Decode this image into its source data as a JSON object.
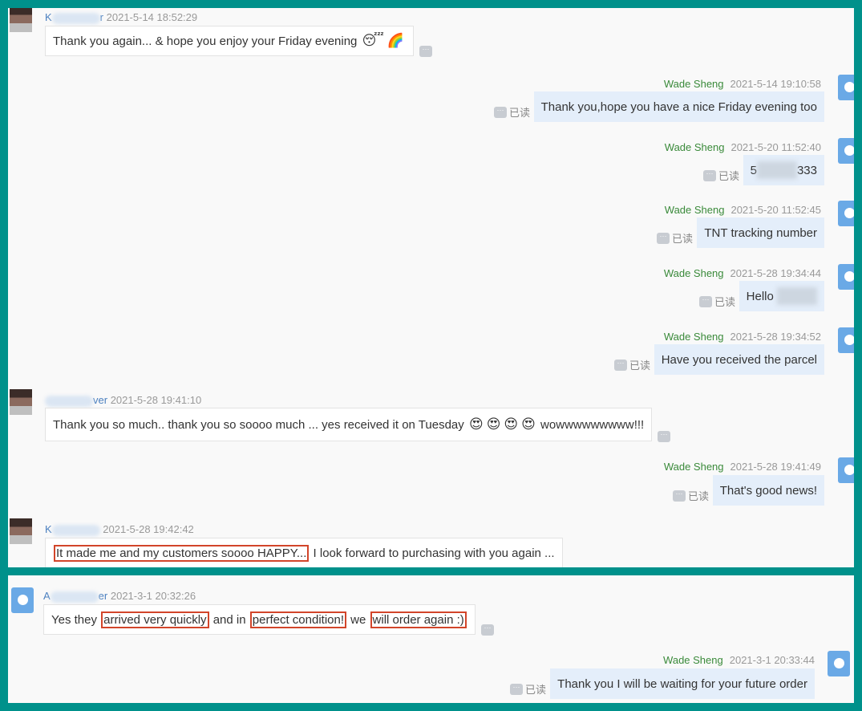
{
  "read_label": "已读",
  "colors": {
    "frame": "#00918b",
    "highlight": "#d2452a",
    "self_name": "#3a8a3a",
    "outgoing_bubble": "#e4eefa"
  },
  "panels": [
    {
      "messages": [
        {
          "dir": "in",
          "name_start": "K",
          "name_end": "r",
          "time": "2021-5-14 18:52:29",
          "segments": [
            {
              "text": "Thank you again... & hope you enjoy your Friday evening "
            },
            {
              "emoji": "😴"
            },
            {
              "emoji": "🌈"
            }
          ]
        },
        {
          "dir": "out",
          "name": "Wade Sheng",
          "time": "2021-5-14 19:10:58",
          "segments": [
            {
              "text": "Thank you,hope you have a nice Friday evening too"
            }
          ]
        },
        {
          "dir": "out",
          "name": "Wade Sheng",
          "time": "2021-5-20 11:52:40",
          "segments": [
            {
              "text": "5"
            },
            {
              "redacted": true
            },
            {
              "text": "333"
            }
          ]
        },
        {
          "dir": "out",
          "name": "Wade Sheng",
          "time": "2021-5-20 11:52:45",
          "segments": [
            {
              "text": "TNT tracking number"
            }
          ]
        },
        {
          "dir": "out",
          "name": "Wade Sheng",
          "time": "2021-5-28 19:34:44",
          "segments": [
            {
              "text": "Hello "
            },
            {
              "redacted": true
            }
          ]
        },
        {
          "dir": "out",
          "name": "Wade Sheng",
          "time": "2021-5-28 19:34:52",
          "segments": [
            {
              "text": "Have you received the parcel"
            }
          ]
        },
        {
          "dir": "in",
          "name_start": "",
          "name_end": "ver",
          "time": "2021-5-28 19:41:10",
          "segments": [
            {
              "text": "Thank you so much.. thank you so soooo much ... yes received it on Tuesday "
            },
            {
              "emoji": "😍"
            },
            {
              "emoji": "😍"
            },
            {
              "emoji": "😍"
            },
            {
              "emoji": "😍"
            },
            {
              "text": " wowwwwwwwww!!!"
            }
          ]
        },
        {
          "dir": "out",
          "name": "Wade Sheng",
          "time": "2021-5-28 19:41:49",
          "segments": [
            {
              "text": "That's good news!"
            }
          ]
        },
        {
          "dir": "in",
          "name_start": "K",
          "name_end": "",
          "time": "2021-5-28 19:42:42",
          "segments": [
            {
              "text": "It made me and my customers soooo HAPPY...",
              "hl": true
            },
            {
              "text": " I look forward to purchasing with you again ..."
            }
          ]
        }
      ]
    },
    {
      "messages": [
        {
          "dir": "in",
          "name_start": "A",
          "name_end": "er",
          "time": "2021-3-1 20:32:26",
          "segments": [
            {
              "text": "Yes they "
            },
            {
              "text": "arrived very quickly",
              "hl": true
            },
            {
              "text": " and in "
            },
            {
              "text": "perfect condition!",
              "hl": true
            },
            {
              "text": " we "
            },
            {
              "text": "will order again :)",
              "hl": true
            }
          ]
        },
        {
          "dir": "out",
          "name": "Wade Sheng",
          "time": "2021-3-1 20:33:44",
          "segments": [
            {
              "text": "Thank you I will be waiting for your future order"
            }
          ]
        }
      ]
    }
  ]
}
